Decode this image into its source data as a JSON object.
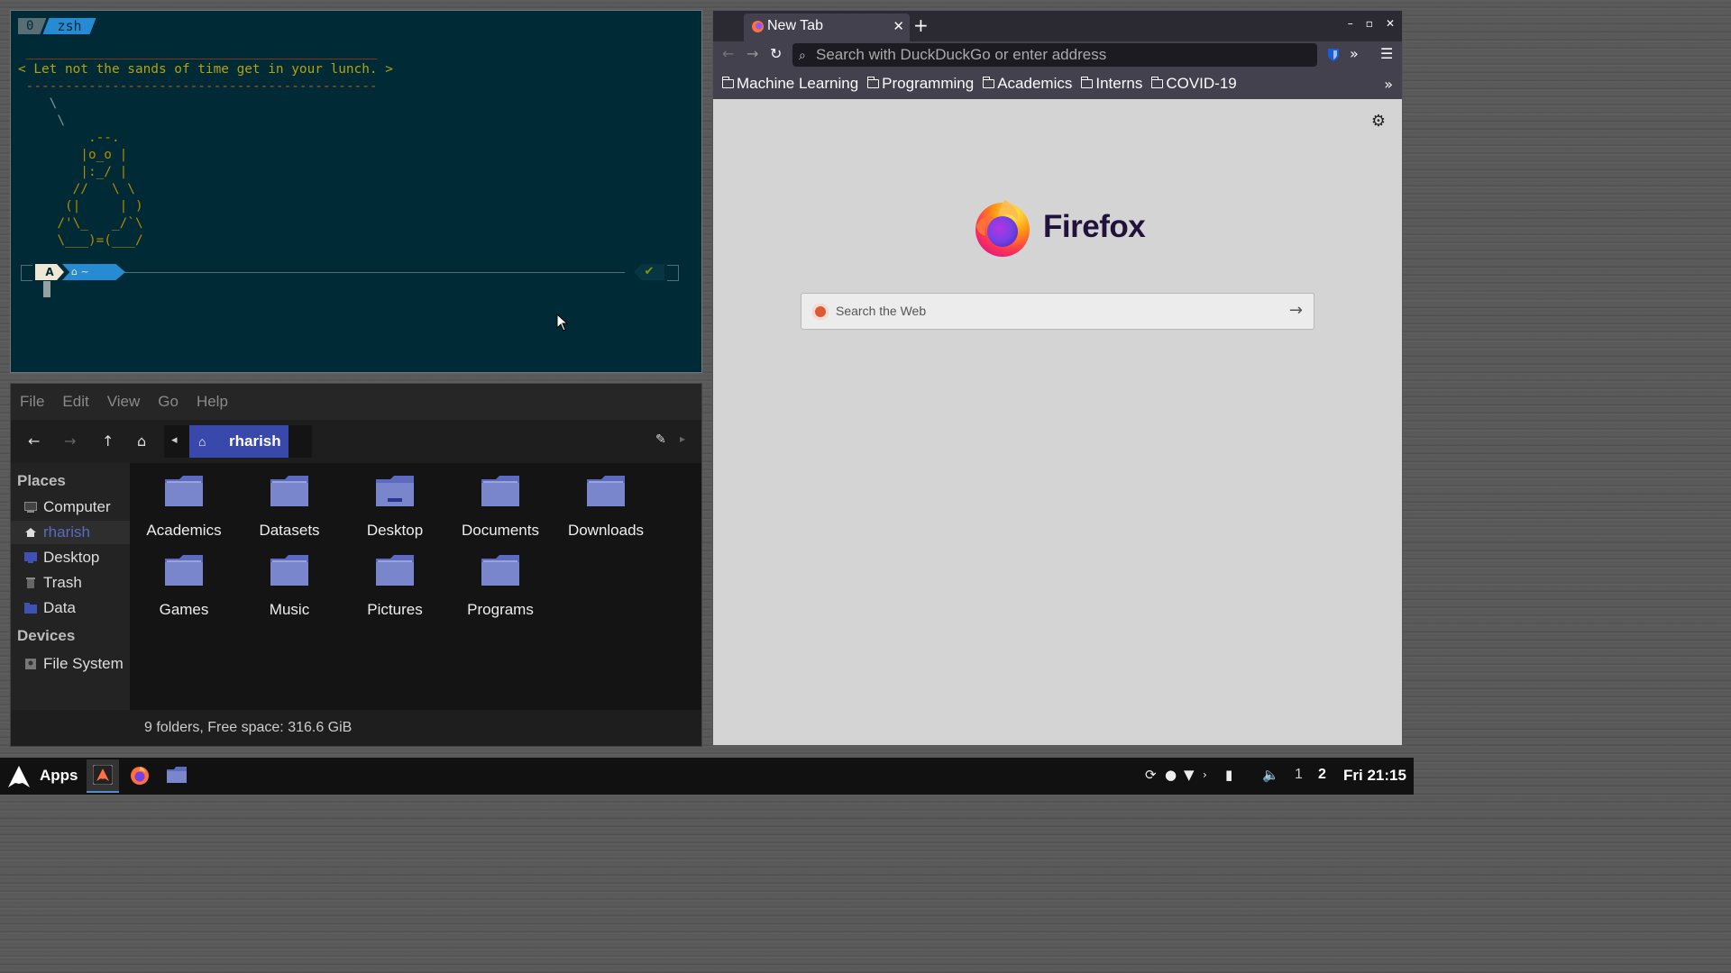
{
  "terminal": {
    "tmux_index": "0",
    "tmux_window": "zsh",
    "cowsay_top": " _____________________________________________",
    "cowsay_text": "< Let not the sands of time get in your lunch. >",
    "cowsay_bottom": " ---------------------------------------------",
    "cowsay_slash": "    \\\n     \\",
    "cowsay_art": "         .--.\n        |o_o |\n        |:_/ |\n       //   \\ \\\n      (|     | )\n     /'\\_   _/`\\\n     \\___)=(___/",
    "prompt_os_symbol": "A",
    "prompt_dir": "⌂ ~",
    "prompt_status": "✔"
  },
  "firefox": {
    "tab_title": "New Tab",
    "tab_close": "✕",
    "new_tab": "+",
    "window_buttons": [
      "–",
      "▫",
      "✕"
    ],
    "back": "←",
    "forward": "→",
    "reload": "↻",
    "url_placeholder": "Search with DuckDuckGo or enter address",
    "overflow": "»",
    "menu": "☰",
    "bookmarks": [
      "Machine Learning",
      "Programming",
      "Academics",
      "Interns",
      "COVID-19"
    ],
    "bookmarks_more": "»",
    "brand": "Firefox",
    "search_placeholder": "Search the Web",
    "search_go": "→",
    "settings": "⚙"
  },
  "files": {
    "menu": [
      "File",
      "Edit",
      "View",
      "Go",
      "Help"
    ],
    "nav": {
      "back": "←",
      "forward": "→",
      "up": "↑",
      "home": "⌂",
      "left": "◂",
      "edit": "✎",
      "right": "▸"
    },
    "breadcrumb": "rharish",
    "breadcrumb_icon": "⌂",
    "sidebar_places_header": "Places",
    "sidebar_places": [
      "Computer",
      "rharish",
      "Desktop",
      "Trash",
      "Data"
    ],
    "sidebar_devices_header": "Devices",
    "sidebar_devices": [
      "File System"
    ],
    "folders": [
      "Academics",
      "Datasets",
      "Desktop",
      "Documents",
      "Downloads",
      "Games",
      "Music",
      "Pictures",
      "Programs"
    ],
    "status": "9 folders, Free space: 316.6 GiB"
  },
  "taskbar": {
    "apps_label": "Apps",
    "workspaces": [
      "1",
      "2"
    ],
    "clock": "Fri 21:15",
    "tray_icons": [
      "sync-icon",
      "check-circle-icon",
      "wifi-icon",
      "chevron-right-icon",
      "battery-icon",
      "volume-icon"
    ]
  },
  "colors": {
    "terminal_bg": "#002b36",
    "accent_blue": "#268bd2",
    "folder_blue": "#5c6bc0",
    "firefox_chrome": "#42414d"
  }
}
